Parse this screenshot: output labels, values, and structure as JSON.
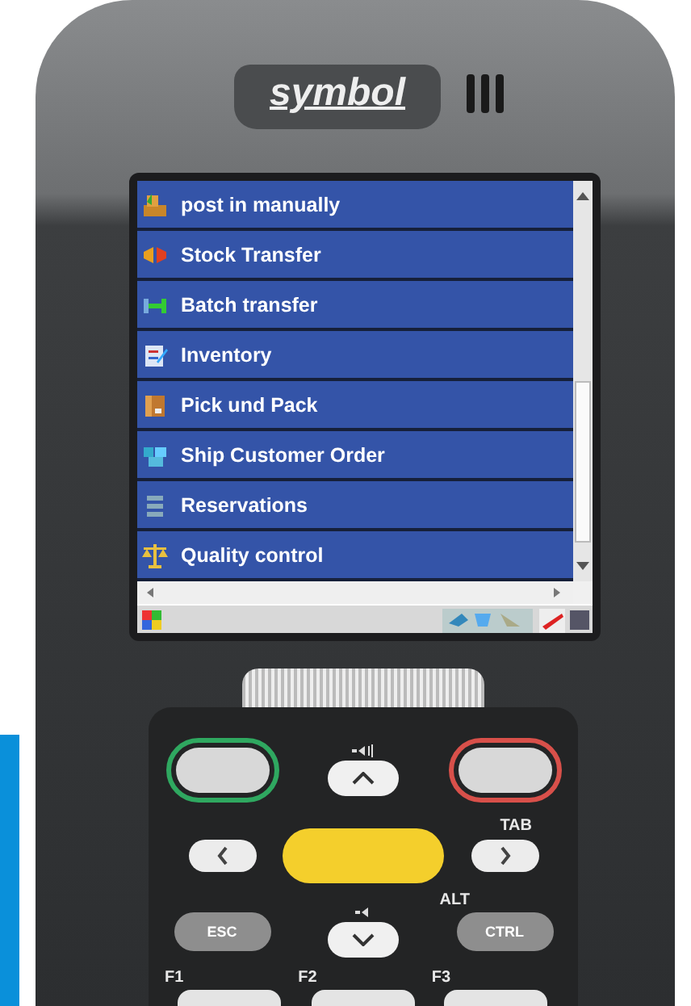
{
  "device": {
    "brand": "symbol"
  },
  "menu_items": [
    {
      "label": "post in manually"
    },
    {
      "label": "Stock Transfer"
    },
    {
      "label": "Batch transfer"
    },
    {
      "label": "Inventory"
    },
    {
      "label": "Pick und Pack"
    },
    {
      "label": "Ship Customer Order"
    },
    {
      "label": "Reservations"
    },
    {
      "label": "Quality control"
    }
  ],
  "keypad": {
    "tab_label": "TAB",
    "alt_label": "ALT",
    "esc_key": "ESC",
    "ctrl_key": "CTRL",
    "function_labels": [
      "F1",
      "F2",
      "F3"
    ]
  }
}
